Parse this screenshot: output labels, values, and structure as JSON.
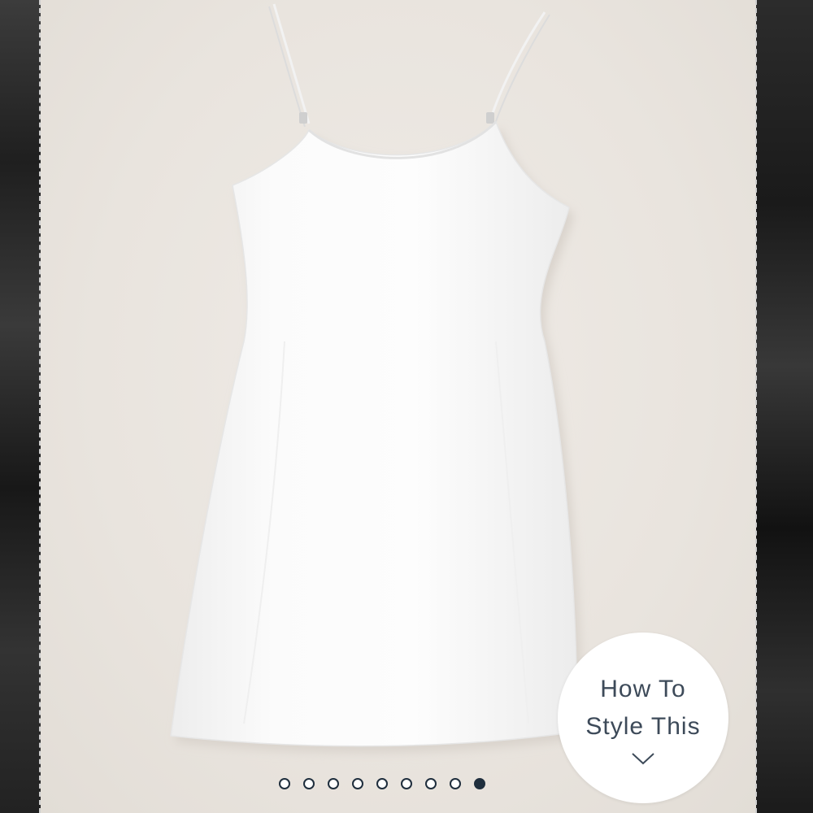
{
  "product_image": {
    "alt": "White mini slip dress with thin adjustable straps",
    "background_color": "#ebe6e0",
    "garment_color": "#fafafa"
  },
  "style_button": {
    "line1": "How To",
    "line2": "Style This",
    "icon": "chevron-down-icon"
  },
  "carousel": {
    "total": 9,
    "active_index": 9
  },
  "colors": {
    "accent": "#1f2e3d",
    "button_text": "#3d4a59"
  }
}
